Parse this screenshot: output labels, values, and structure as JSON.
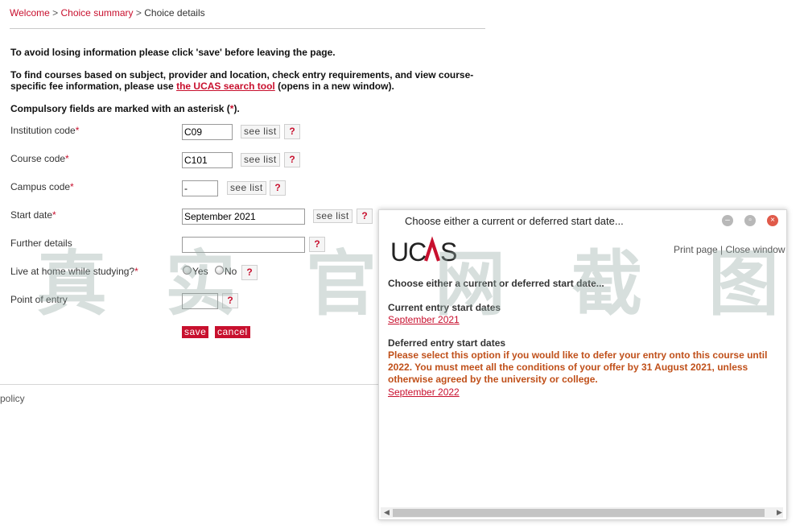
{
  "breadcrumb": {
    "welcome": "Welcome",
    "sep1": ">",
    "summary": "Choice summary",
    "sep2": ">",
    "current": "Choice details"
  },
  "messages": {
    "save_warning": "To avoid losing information please click 'save' before leaving the page.",
    "find_prefix": "To find courses based on subject, provider and location, check entry requirements, and view course-specific fee information, please use ",
    "find_link": "the UCAS search tool",
    "find_suffix": " (opens in a new window).",
    "compulsory_prefix": "Compulsory fields are marked with an asterisk (",
    "compulsory_ast": "*",
    "compulsory_suffix": ")."
  },
  "form": {
    "asterisk": "*",
    "see_list": "see list",
    "help": "?",
    "institution": {
      "label": "Institution code",
      "value": "C09"
    },
    "course": {
      "label": "Course code",
      "value": "C101"
    },
    "campus": {
      "label": "Campus code",
      "value": "-"
    },
    "start": {
      "label": "Start date",
      "value": "September 2021"
    },
    "further": {
      "label": "Further details",
      "value": ""
    },
    "live": {
      "label": "Live at home while studying?",
      "yes": "Yes",
      "no": "No"
    },
    "poe": {
      "label": "Point of entry",
      "value": ""
    },
    "save": "save",
    "cancel": "cancel"
  },
  "footer": {
    "text": "policy"
  },
  "watermark": [
    "真",
    "实",
    "官",
    "网",
    "截",
    "图"
  ],
  "popup": {
    "title": "Choose either a current or deferred start date...",
    "print": "Print page",
    "divider": "|",
    "close": "Close window",
    "heading": "Choose either a current or deferred start date...",
    "current_heading": "Current entry start dates",
    "current_option": "September 2021",
    "deferred_heading": "Deferred entry start dates",
    "deferred_note": "Please select this option if you would like to defer your entry onto this course until 2022. You must meet all the conditions of your offer by 31 August 2021, unless otherwise agreed by the university or college.",
    "deferred_option": "September 2022"
  },
  "colors": {
    "brand_red": "#c8102e",
    "note_orange": "#c0501a"
  }
}
